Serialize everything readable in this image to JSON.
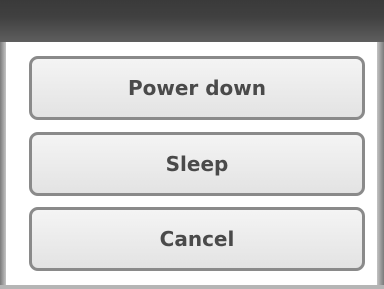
{
  "dialog": {
    "buttons": {
      "power_down": "Power down",
      "sleep": "Sleep",
      "cancel": "Cancel"
    }
  }
}
